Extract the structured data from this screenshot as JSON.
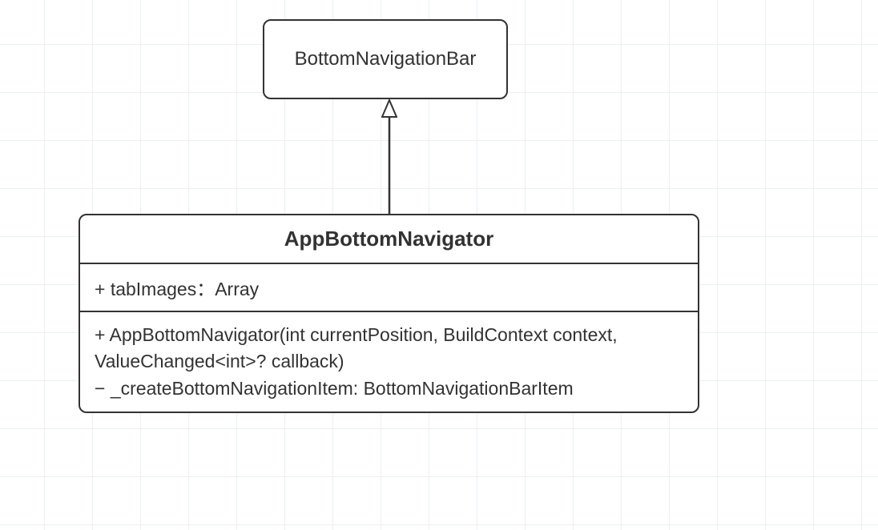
{
  "diagram": {
    "parent": {
      "name": "BottomNavigationBar"
    },
    "child": {
      "name": "AppBottomNavigator",
      "attributes": [
        "+ tabImages：Array"
      ],
      "operations": [
        "+ AppBottomNavigator(int currentPosition, BuildContext context, ValueChanged<int>? callback)",
        "− _createBottomNavigationItem: BottomNavigationBarItem"
      ]
    },
    "relation": "generalization"
  }
}
